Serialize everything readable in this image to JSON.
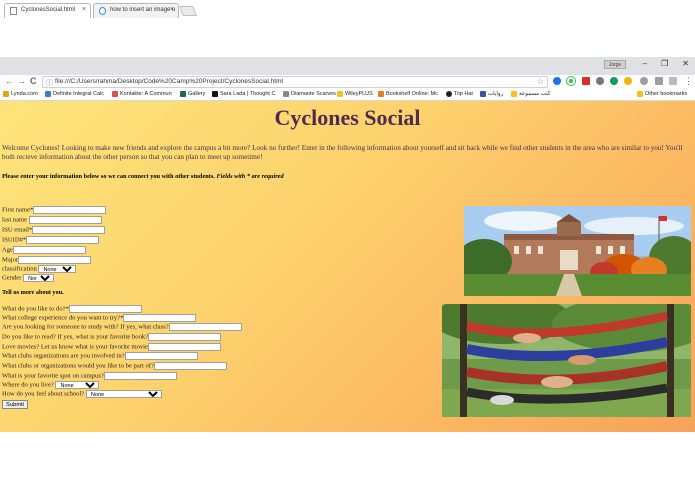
{
  "browser": {
    "tabs": [
      {
        "label": "CyclonesSocial.html",
        "close": "×"
      },
      {
        "label": "how to insert an image u",
        "close": "×"
      }
    ],
    "user_chip": "Jorge",
    "window_controls": {
      "minimize": "–",
      "restore": "❐",
      "close": "✕"
    },
    "nav": {
      "back": "←",
      "forward": "→",
      "reload": "C"
    },
    "address": "file:///C:/Users/rahma/Desktop/Code%20Camp%20Project/CyclonesSocial.html",
    "address_info": "ⓘ",
    "star": "☆",
    "menu": "⋮",
    "bookmarks": [
      {
        "label": "Lynda.com",
        "color": "#e8a317"
      },
      {
        "label": "Definite Integral Calc",
        "color": "#3a7bd5"
      },
      {
        "label": "Kontakte: A Commun",
        "color": "#d9534f"
      },
      {
        "label": "Gallery",
        "color": "#1c6e3e"
      },
      {
        "label": "Sara Lada | Thought C",
        "color": "#111111"
      },
      {
        "label": "Diamante Scarves",
        "color": "#888888"
      },
      {
        "label": "WileyPLUS",
        "color": "#f0c419"
      },
      {
        "label": "Bookshelf Online: Mc",
        "color": "#e67e22"
      },
      {
        "label": "Top Hat",
        "color": "#222222"
      },
      {
        "label": "روايات",
        "color": "#3b5998"
      },
      {
        "label": "كتب مسموعة",
        "color": "#f0c419"
      }
    ],
    "other_bookmarks": "Other bookmarks"
  },
  "page": {
    "title": "Cyclones Social",
    "intro": "Welcome Cyclones! Looking to make new friends and explore the campus a bit more? Look no further! Enter in the following information about yourself and sit back while we find other students in the area who are similar to you! You'll both recieve information about the other person so that you can plan to meet up sometime!",
    "note_bold": "Please enter your information below so we can connect you with other students.",
    "note_italic": "Fields with * are required",
    "fields1": [
      {
        "label": "First name*"
      },
      {
        "label": "last name"
      },
      {
        "label": "ISU email*"
      },
      {
        "label": "ISUID#*"
      },
      {
        "label": "Age"
      },
      {
        "label": "Major"
      }
    ],
    "classification": {
      "label": "classification",
      "value": "None"
    },
    "gender": {
      "label": "Gender",
      "value": "None"
    },
    "section2_title": "Tell us more about you.",
    "fields2": [
      {
        "label": "What do you like to do?*"
      },
      {
        "label": "What college experience do you want to try?*"
      },
      {
        "label": "Are you looking for someone to study with? If yes, what class?"
      },
      {
        "label": "Do you like to read? If yes, what is your favorite book?"
      },
      {
        "label": "Love movies? Let us know what is your favorite movie"
      },
      {
        "label": "What clubs organizations are you involved in?"
      },
      {
        "label": "What clubs or organizations would you like to be part of?"
      },
      {
        "label": "What is your favorite spot on campus?"
      }
    ],
    "live": {
      "label": "Where do you live?",
      "value": "None"
    },
    "feel": {
      "label": "How do you feel about school?",
      "value": "None"
    },
    "submit": "Submit"
  }
}
